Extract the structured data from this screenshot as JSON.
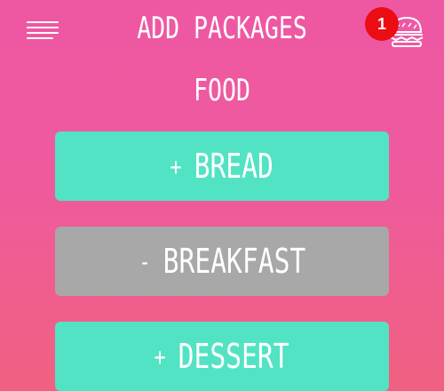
{
  "header": {
    "title": "ADD PACKAGES",
    "menu_icon": "hamburger-menu-icon",
    "cart_icon": "burger-cart-icon",
    "cart_count": "1",
    "badge_color": "#ec0d14"
  },
  "section": {
    "title": "FOOD"
  },
  "packages": [
    {
      "sign": "+",
      "label": "BREAD",
      "state": "available",
      "color": "#52e3c4"
    },
    {
      "sign": "-",
      "label": "BREAKFAST",
      "state": "added",
      "color": "#a9a8a8"
    },
    {
      "sign": "+",
      "label": "DESSERT",
      "state": "available",
      "color": "#52e3c4"
    }
  ],
  "colors": {
    "background_top": "#ee58a3",
    "background_bottom": "#f06181",
    "text": "#ffffff"
  }
}
